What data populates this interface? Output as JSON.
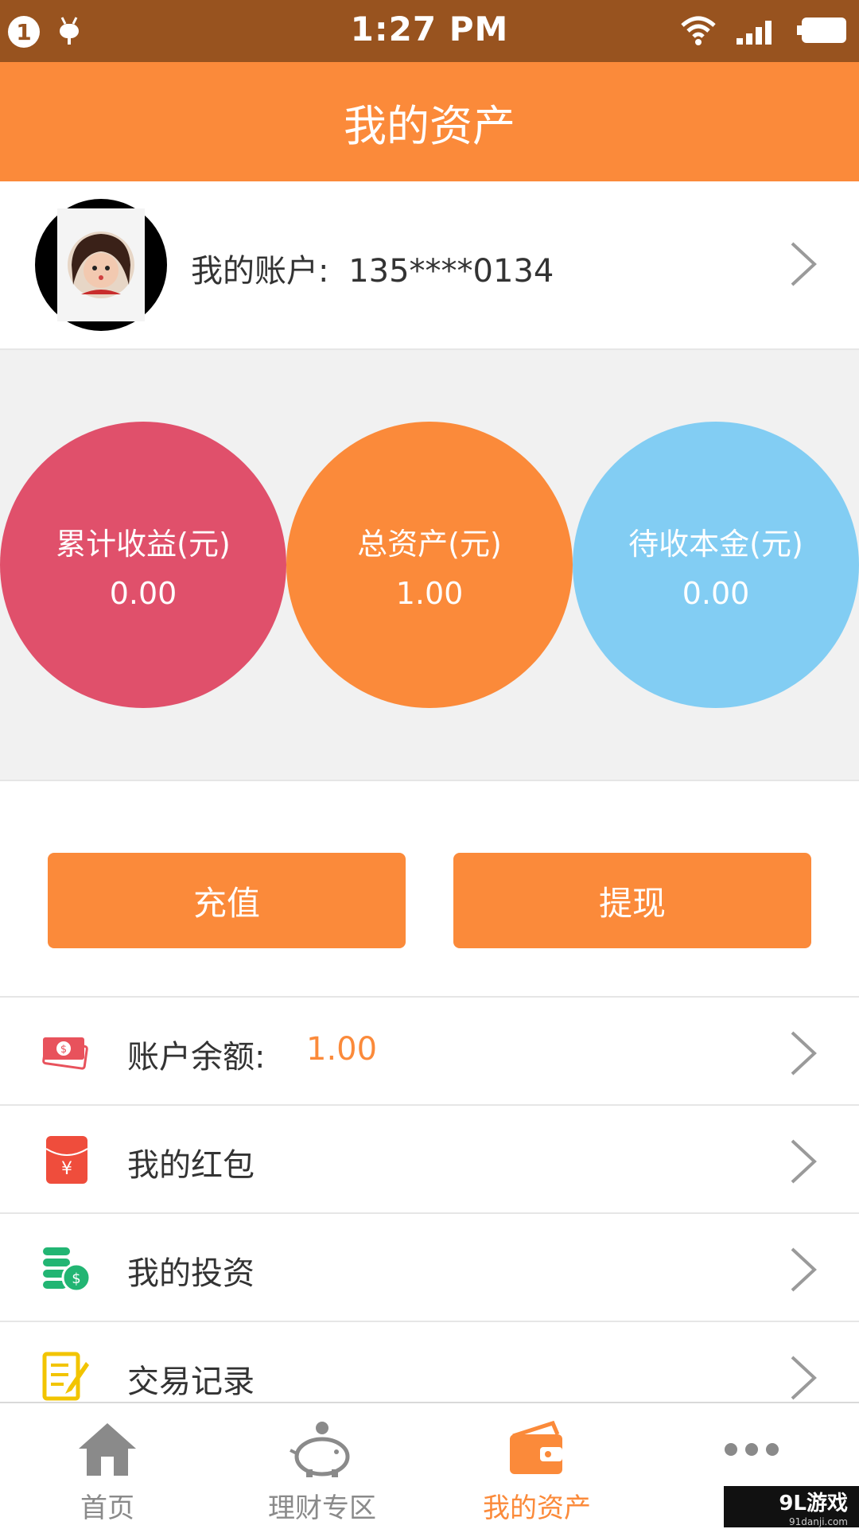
{
  "status_bar": {
    "notification_count": "1",
    "time": "1:27 PM"
  },
  "header": {
    "title": "我的资产"
  },
  "account": {
    "label": "我的账户:",
    "phone": "135****0134"
  },
  "stats": [
    {
      "title": "累计收益(元)",
      "value": "0.00",
      "color": "#E0506B"
    },
    {
      "title": "总资产(元)",
      "value": "1.00",
      "color": "#FB8A3A"
    },
    {
      "title": "待收本金(元)",
      "value": "0.00",
      "color": "#82CDF3"
    }
  ],
  "actions": {
    "recharge": "充值",
    "withdraw": "提现"
  },
  "menu": [
    {
      "label": "账户余额:",
      "value": "1.00",
      "icon": "money-stack-icon"
    },
    {
      "label": "我的红包",
      "icon": "red-envelope-icon"
    },
    {
      "label": "我的投资",
      "icon": "coins-icon"
    },
    {
      "label": "交易记录",
      "icon": "ledger-icon"
    }
  ],
  "tabs": [
    {
      "label": "首页",
      "icon": "home-icon"
    },
    {
      "label": "理财专区",
      "icon": "piggy-bank-icon"
    },
    {
      "label": "我的资产",
      "icon": "wallet-icon",
      "active": true
    },
    {
      "label": "更多",
      "icon": "more-icon"
    }
  ],
  "watermark": {
    "brand": "9L游戏",
    "site": "91danji.com"
  },
  "colors": {
    "accent": "#FB8A3A",
    "status_bar": "#98531F",
    "stat_red": "#E0506B",
    "stat_blue": "#82CDF3"
  }
}
